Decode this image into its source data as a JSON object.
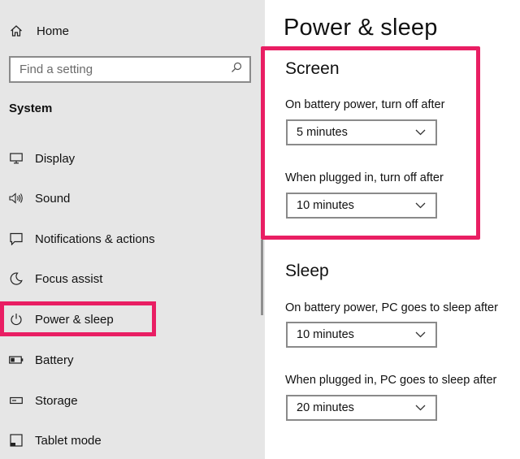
{
  "sidebar": {
    "home_label": "Home",
    "search_placeholder": "Find a setting",
    "section_title": "System",
    "items": [
      {
        "label": "Display",
        "icon": "monitor-icon"
      },
      {
        "label": "Sound",
        "icon": "speaker-icon"
      },
      {
        "label": "Notifications & actions",
        "icon": "notification-icon"
      },
      {
        "label": "Focus assist",
        "icon": "moon-icon"
      },
      {
        "label": "Power & sleep",
        "icon": "power-icon",
        "selected": true
      },
      {
        "label": "Battery",
        "icon": "battery-icon"
      },
      {
        "label": "Storage",
        "icon": "storage-icon"
      },
      {
        "label": "Tablet mode",
        "icon": "tablet-icon"
      }
    ]
  },
  "main": {
    "title": "Power & sleep",
    "screen": {
      "title": "Screen",
      "battery_label": "On battery power, turn off after",
      "battery_value": "5 minutes",
      "plugged_label": "When plugged in, turn off after",
      "plugged_value": "10 minutes"
    },
    "sleep": {
      "title": "Sleep",
      "battery_label": "On battery power, PC goes to sleep after",
      "battery_value": "10 minutes",
      "plugged_label": "When plugged in, PC goes to sleep after",
      "plugged_value": "20 minutes"
    }
  },
  "colors": {
    "sidebar_bg": "#e6e6e6",
    "highlight": "#e91e63",
    "border": "#8a8a8a"
  }
}
